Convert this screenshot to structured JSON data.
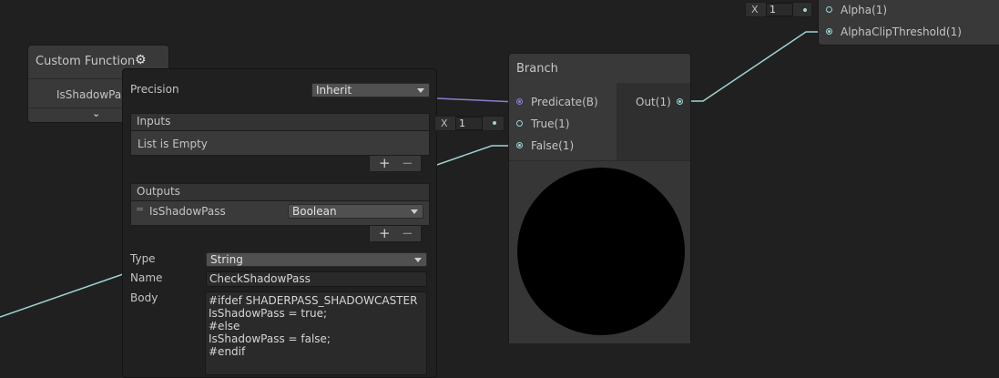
{
  "alpha_node": {
    "ports": [
      {
        "label": "Alpha(1)",
        "value": "1",
        "x_label": "X"
      },
      {
        "label": "AlphaClipThreshold(1)"
      }
    ]
  },
  "custom_function_node": {
    "title": "Custom Function",
    "output_port": "IsShadowPass(B)"
  },
  "settings_panel": {
    "precision_label": "Precision",
    "precision_value": "Inherit",
    "inputs_header": "Inputs",
    "inputs_empty": "List is Empty",
    "outputs_header": "Outputs",
    "outputs": [
      {
        "name": "IsShadowPass",
        "type": "Boolean"
      }
    ],
    "add_label": "+",
    "remove_label": "−",
    "type_label": "Type",
    "type_value": "String",
    "name_label": "Name",
    "name_value": "CheckShadowPass",
    "body_label": "Body",
    "body_value": "#ifdef SHADERPASS_SHADOWCASTER\nIsShadowPass = true;\n#else\nIsShadowPass = false;\n#endif"
  },
  "branch_node": {
    "title": "Branch",
    "inputs": [
      {
        "label": "Predicate(B)"
      },
      {
        "label": "True(1)",
        "value": "1",
        "x_label": "X"
      },
      {
        "label": "False(1)"
      }
    ],
    "output": "Out(1)"
  },
  "colors": {
    "background": "#202020",
    "node": "#393939",
    "wire_float": "#9fd3d3",
    "wire_bool": "#8a7fd0"
  }
}
